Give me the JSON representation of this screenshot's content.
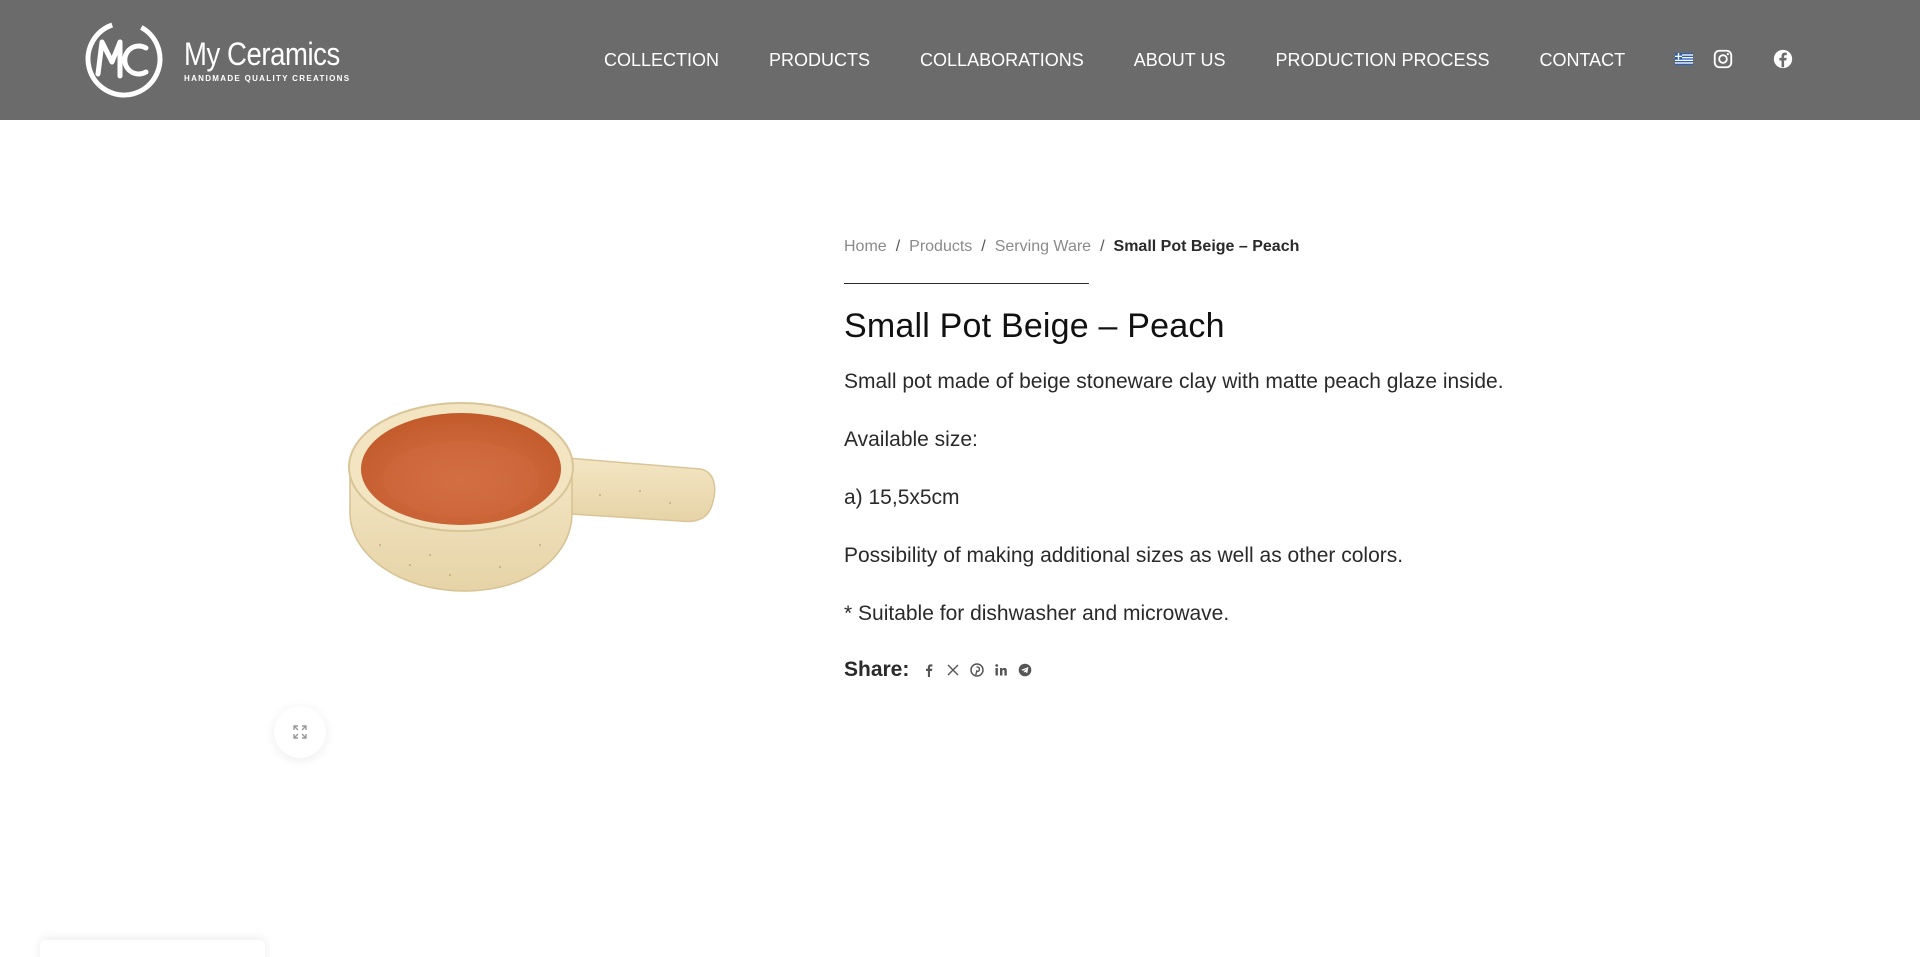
{
  "brand": {
    "name": "My Ceramics",
    "tagline": "HANDMADE QUALITY CREATIONS"
  },
  "nav": {
    "items": [
      {
        "label": "COLLECTION"
      },
      {
        "label": "PRODUCTS"
      },
      {
        "label": "COLLABORATIONS"
      },
      {
        "label": "ABOUT US"
      },
      {
        "label": "PRODUCTION PROCESS"
      },
      {
        "label": "CONTACT"
      }
    ],
    "language_icon": "greek-flag-icon",
    "social_icons": [
      "instagram-icon",
      "facebook-icon"
    ]
  },
  "breadcrumb": {
    "items": [
      "Home",
      "Products",
      "Serving Ware"
    ],
    "separator": "/",
    "current": "Small Pot Beige – Peach"
  },
  "product": {
    "title": "Small Pot Beige – Peach",
    "description": [
      "Small pot made of beige stoneware clay with matte peach glaze inside.",
      "Available size:",
      "a) 15,5x5cm",
      "Possibility of making additional sizes as well as other colors.",
      "* Suitable for dishwasher and microwave."
    ],
    "image_icon": "ceramic-pot-image",
    "zoom_icon": "expand-icon"
  },
  "share": {
    "label": "Share:",
    "icons": [
      "facebook-icon",
      "x-icon",
      "pinterest-icon",
      "linkedin-icon",
      "telegram-icon"
    ]
  },
  "colors": {
    "header_bg": "#6b6b6b",
    "text": "#2a2a2a",
    "muted": "#8a8a8a",
    "glaze": "#d56a38",
    "clay": "#f0e1bd"
  }
}
